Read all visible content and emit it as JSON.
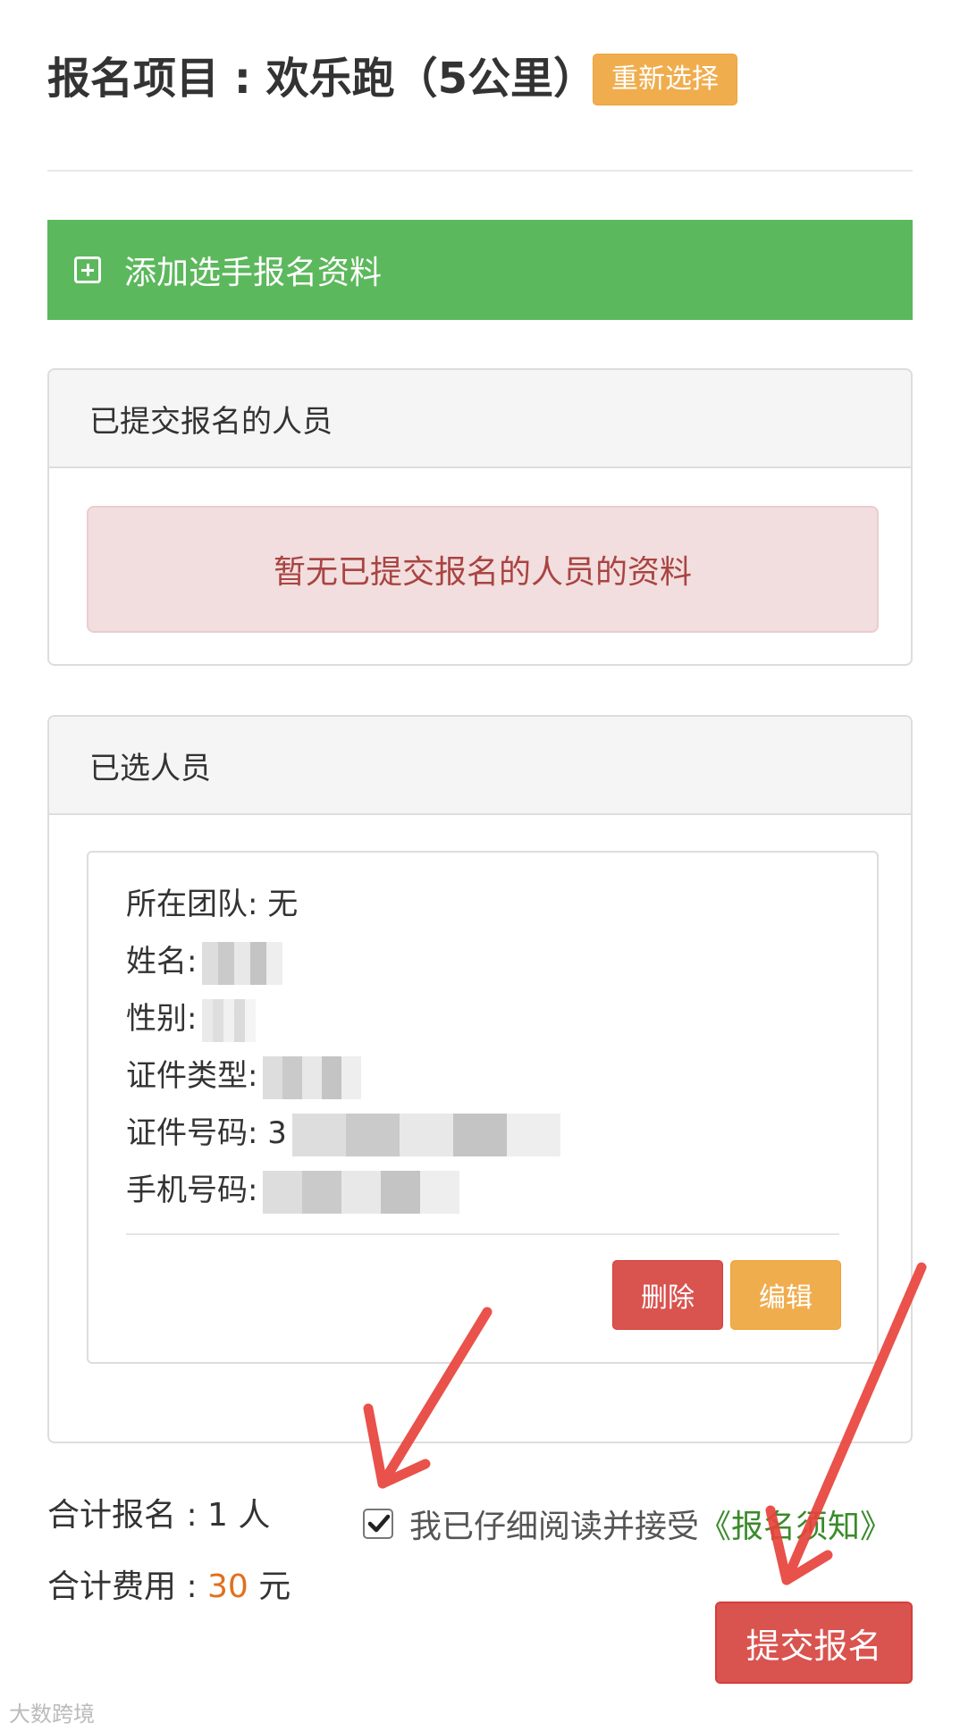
{
  "header": {
    "title": "报名项目 : 欢乐跑（5公里）",
    "reselect_label": "重新选择"
  },
  "add_button": {
    "label": "添加选手报名资料",
    "icon": "plus-square-icon"
  },
  "submitted_panel": {
    "title": "已提交报名的人员",
    "empty_message": "暂无已提交报名的人员的资料"
  },
  "selected_panel": {
    "title": "已选人员",
    "person": {
      "team_label": "所在团队: 无",
      "name_label": "姓名:",
      "gender_label": "性别:",
      "id_type_label": "证件类型:",
      "id_number_label": "证件号码: 3",
      "phone_label": "手机号码:"
    },
    "delete_label": "删除",
    "edit_label": "编辑"
  },
  "summary": {
    "count_label": "合计报名 : 1 人",
    "fee_prefix": "合计费用 : ",
    "fee_value": "30",
    "fee_suffix": " 元"
  },
  "agreement": {
    "checked": true,
    "text": "我已仔细阅读并接受",
    "link_text": "《报名须知》"
  },
  "submit_label": "提交报名",
  "watermark": "大数跨境",
  "colors": {
    "success": "#5cb85c",
    "warning": "#f0ad4e",
    "danger": "#d9534f",
    "link": "#3a8a2b",
    "fee": "#e0701c",
    "arrow": "#e8433c"
  }
}
